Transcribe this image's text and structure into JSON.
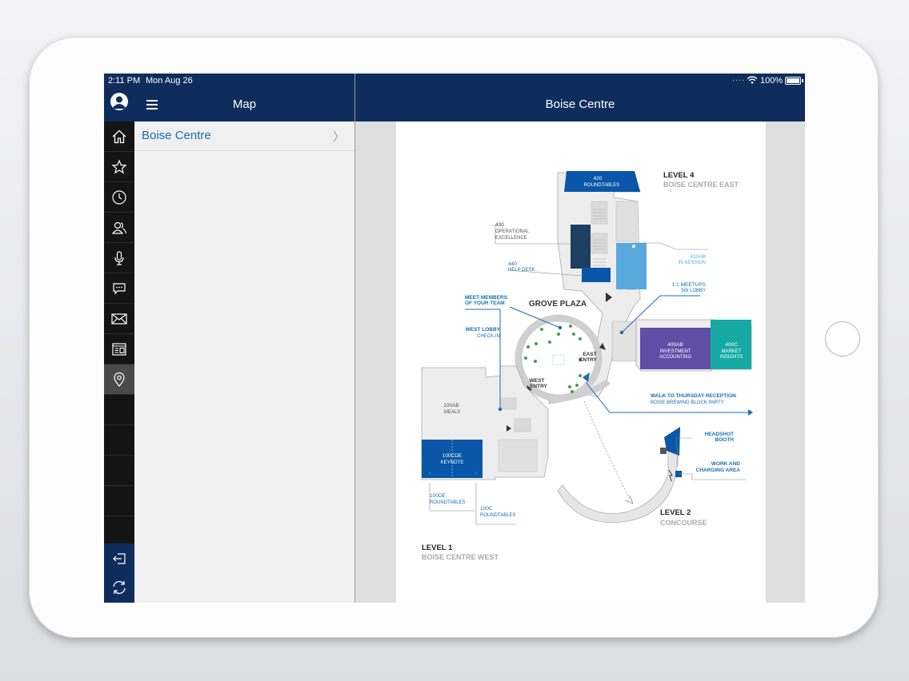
{
  "status": {
    "time": "2:11 PM",
    "date": "Mon Aug 26",
    "battery": "100%",
    "dots": "....",
    "wifi_icon": "wifi-icon"
  },
  "master": {
    "title": "Map",
    "items": [
      {
        "label": "Boise Centre",
        "chevron": "〉"
      }
    ]
  },
  "detail": {
    "title": "Boise Centre"
  },
  "rail": {
    "icons": [
      "home-icon",
      "star-icon",
      "clock-icon",
      "people-icon",
      "microphone-icon",
      "chat-icon",
      "mail-icon",
      "news-icon",
      "map-pin-icon"
    ],
    "bottom": [
      "logout-icon",
      "refresh-icon"
    ],
    "active": "map-pin-icon"
  },
  "colors": {
    "navy": "#0e2d5c",
    "blue": "#1a6db3",
    "royal": "#0a56a8",
    "dark_navy": "#1d3f62",
    "light_blue": "#5aa9de",
    "purple": "#5f4ea6",
    "teal": "#17a9a4",
    "green": "#43a047"
  },
  "map": {
    "level4": "LEVEL 4",
    "level4_sub": "BOISE CENTRE EAST",
    "level2": "LEVEL 2",
    "level2_sub": "CONCOURSE",
    "level1": "LEVEL 1",
    "level1_sub": "BOISE CENTRE WEST",
    "grove": "GROVE PLAZA",
    "r420_num": "420",
    "r420_name": "ROUNDTABLES",
    "r430_num": "430",
    "r430_l1": "OPERATIONAL",
    "r430_l2": "EXCELLENCE",
    "r440_num": "440",
    "r440_name": "HELP DESK",
    "r410_num": "410AB",
    "r410_name": "IN-SESSION",
    "meetups_l1": "1:1 MEETUPS",
    "meetups_l2": "5W LOBBY",
    "members_l1": "MEET MEMBERS",
    "members_l2": "OF YOUR TEAM",
    "west_lobby_l1": "WEST LOBBY",
    "west_lobby_l2": "CHECK-IN",
    "r400ab_num": "400AB",
    "r400ab_l1": "INVESTMENT",
    "r400ab_l2": "ACCOUNTING",
    "r400c_num": "400C",
    "r400c_l1": "MARKET",
    "r400c_l2": "INSIGHTS",
    "east_l1": "EAST",
    "east_l2": "ENTRY",
    "west_l1": "WEST",
    "west_l2": "ENTRY",
    "walk_l1": "WALK TO THURSDAY RECEPTION",
    "walk_l2": "BOISE BREWING BLOCK PARTY",
    "r100ab_num": "100AB",
    "r100ab_name": "MEALS",
    "r100cde_num": "100CDE",
    "r100cde_name": "KEYNOTE",
    "headshot_l1": "HEADSHOT",
    "headshot_l2": "BOOTH",
    "work_l1": "WORK AND",
    "work_l2": "CHARGING AREA",
    "r100de_num": "100DE",
    "r100de_name": "ROUNDTABLES",
    "r100c_num": "100C",
    "r100c_name": "ROUNDTABLES"
  }
}
